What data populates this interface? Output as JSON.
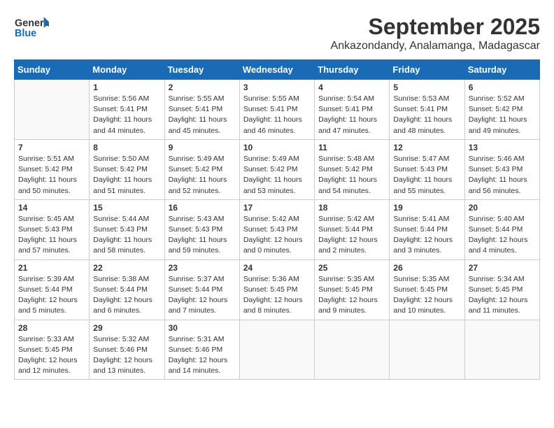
{
  "header": {
    "logo_general": "General",
    "logo_blue": "Blue",
    "month": "September 2025",
    "location": "Ankazondandy, Analamanga, Madagascar"
  },
  "weekdays": [
    "Sunday",
    "Monday",
    "Tuesday",
    "Wednesday",
    "Thursday",
    "Friday",
    "Saturday"
  ],
  "weeks": [
    [
      {
        "day": "",
        "sunrise": "",
        "sunset": "",
        "daylight": ""
      },
      {
        "day": "1",
        "sunrise": "Sunrise: 5:56 AM",
        "sunset": "Sunset: 5:41 PM",
        "daylight": "Daylight: 11 hours and 44 minutes."
      },
      {
        "day": "2",
        "sunrise": "Sunrise: 5:55 AM",
        "sunset": "Sunset: 5:41 PM",
        "daylight": "Daylight: 11 hours and 45 minutes."
      },
      {
        "day": "3",
        "sunrise": "Sunrise: 5:55 AM",
        "sunset": "Sunset: 5:41 PM",
        "daylight": "Daylight: 11 hours and 46 minutes."
      },
      {
        "day": "4",
        "sunrise": "Sunrise: 5:54 AM",
        "sunset": "Sunset: 5:41 PM",
        "daylight": "Daylight: 11 hours and 47 minutes."
      },
      {
        "day": "5",
        "sunrise": "Sunrise: 5:53 AM",
        "sunset": "Sunset: 5:41 PM",
        "daylight": "Daylight: 11 hours and 48 minutes."
      },
      {
        "day": "6",
        "sunrise": "Sunrise: 5:52 AM",
        "sunset": "Sunset: 5:42 PM",
        "daylight": "Daylight: 11 hours and 49 minutes."
      }
    ],
    [
      {
        "day": "7",
        "sunrise": "Sunrise: 5:51 AM",
        "sunset": "Sunset: 5:42 PM",
        "daylight": "Daylight: 11 hours and 50 minutes."
      },
      {
        "day": "8",
        "sunrise": "Sunrise: 5:50 AM",
        "sunset": "Sunset: 5:42 PM",
        "daylight": "Daylight: 11 hours and 51 minutes."
      },
      {
        "day": "9",
        "sunrise": "Sunrise: 5:49 AM",
        "sunset": "Sunset: 5:42 PM",
        "daylight": "Daylight: 11 hours and 52 minutes."
      },
      {
        "day": "10",
        "sunrise": "Sunrise: 5:49 AM",
        "sunset": "Sunset: 5:42 PM",
        "daylight": "Daylight: 11 hours and 53 minutes."
      },
      {
        "day": "11",
        "sunrise": "Sunrise: 5:48 AM",
        "sunset": "Sunset: 5:42 PM",
        "daylight": "Daylight: 11 hours and 54 minutes."
      },
      {
        "day": "12",
        "sunrise": "Sunrise: 5:47 AM",
        "sunset": "Sunset: 5:43 PM",
        "daylight": "Daylight: 11 hours and 55 minutes."
      },
      {
        "day": "13",
        "sunrise": "Sunrise: 5:46 AM",
        "sunset": "Sunset: 5:43 PM",
        "daylight": "Daylight: 11 hours and 56 minutes."
      }
    ],
    [
      {
        "day": "14",
        "sunrise": "Sunrise: 5:45 AM",
        "sunset": "Sunset: 5:43 PM",
        "daylight": "Daylight: 11 hours and 57 minutes."
      },
      {
        "day": "15",
        "sunrise": "Sunrise: 5:44 AM",
        "sunset": "Sunset: 5:43 PM",
        "daylight": "Daylight: 11 hours and 58 minutes."
      },
      {
        "day": "16",
        "sunrise": "Sunrise: 5:43 AM",
        "sunset": "Sunset: 5:43 PM",
        "daylight": "Daylight: 11 hours and 59 minutes."
      },
      {
        "day": "17",
        "sunrise": "Sunrise: 5:42 AM",
        "sunset": "Sunset: 5:43 PM",
        "daylight": "Daylight: 12 hours and 0 minutes."
      },
      {
        "day": "18",
        "sunrise": "Sunrise: 5:42 AM",
        "sunset": "Sunset: 5:44 PM",
        "daylight": "Daylight: 12 hours and 2 minutes."
      },
      {
        "day": "19",
        "sunrise": "Sunrise: 5:41 AM",
        "sunset": "Sunset: 5:44 PM",
        "daylight": "Daylight: 12 hours and 3 minutes."
      },
      {
        "day": "20",
        "sunrise": "Sunrise: 5:40 AM",
        "sunset": "Sunset: 5:44 PM",
        "daylight": "Daylight: 12 hours and 4 minutes."
      }
    ],
    [
      {
        "day": "21",
        "sunrise": "Sunrise: 5:39 AM",
        "sunset": "Sunset: 5:44 PM",
        "daylight": "Daylight: 12 hours and 5 minutes."
      },
      {
        "day": "22",
        "sunrise": "Sunrise: 5:38 AM",
        "sunset": "Sunset: 5:44 PM",
        "daylight": "Daylight: 12 hours and 6 minutes."
      },
      {
        "day": "23",
        "sunrise": "Sunrise: 5:37 AM",
        "sunset": "Sunset: 5:44 PM",
        "daylight": "Daylight: 12 hours and 7 minutes."
      },
      {
        "day": "24",
        "sunrise": "Sunrise: 5:36 AM",
        "sunset": "Sunset: 5:45 PM",
        "daylight": "Daylight: 12 hours and 8 minutes."
      },
      {
        "day": "25",
        "sunrise": "Sunrise: 5:35 AM",
        "sunset": "Sunset: 5:45 PM",
        "daylight": "Daylight: 12 hours and 9 minutes."
      },
      {
        "day": "26",
        "sunrise": "Sunrise: 5:35 AM",
        "sunset": "Sunset: 5:45 PM",
        "daylight": "Daylight: 12 hours and 10 minutes."
      },
      {
        "day": "27",
        "sunrise": "Sunrise: 5:34 AM",
        "sunset": "Sunset: 5:45 PM",
        "daylight": "Daylight: 12 hours and 11 minutes."
      }
    ],
    [
      {
        "day": "28",
        "sunrise": "Sunrise: 5:33 AM",
        "sunset": "Sunset: 5:45 PM",
        "daylight": "Daylight: 12 hours and 12 minutes."
      },
      {
        "day": "29",
        "sunrise": "Sunrise: 5:32 AM",
        "sunset": "Sunset: 5:46 PM",
        "daylight": "Daylight: 12 hours and 13 minutes."
      },
      {
        "day": "30",
        "sunrise": "Sunrise: 5:31 AM",
        "sunset": "Sunset: 5:46 PM",
        "daylight": "Daylight: 12 hours and 14 minutes."
      },
      {
        "day": "",
        "sunrise": "",
        "sunset": "",
        "daylight": ""
      },
      {
        "day": "",
        "sunrise": "",
        "sunset": "",
        "daylight": ""
      },
      {
        "day": "",
        "sunrise": "",
        "sunset": "",
        "daylight": ""
      },
      {
        "day": "",
        "sunrise": "",
        "sunset": "",
        "daylight": ""
      }
    ]
  ]
}
